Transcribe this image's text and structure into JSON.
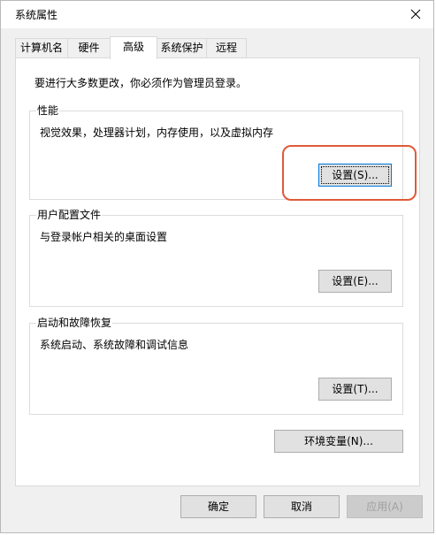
{
  "window": {
    "title": "系统属性"
  },
  "tabs": [
    {
      "label": "计算机名",
      "active": false
    },
    {
      "label": "硬件",
      "active": false
    },
    {
      "label": "高级",
      "active": true
    },
    {
      "label": "系统保护",
      "active": false
    },
    {
      "label": "远程",
      "active": false
    }
  ],
  "advanced": {
    "notice": "要进行大多数更改，你必须作为管理员登录。",
    "performance": {
      "title": "性能",
      "description": "视觉效果，处理器计划，内存使用，以及虚拟内存",
      "button": "设置(S)..."
    },
    "user_profiles": {
      "title": "用户配置文件",
      "description": "与登录帐户相关的桌面设置",
      "button": "设置(E)..."
    },
    "startup_recovery": {
      "title": "启动和故障恢复",
      "description": "系统启动、系统故障和调试信息",
      "button": "设置(T)..."
    },
    "env_button": "环境变量(N)..."
  },
  "footer": {
    "ok": "确定",
    "cancel": "取消",
    "apply": "应用(A)"
  },
  "colors": {
    "highlight": "#e05a3a",
    "focus_border": "#0078d7"
  }
}
